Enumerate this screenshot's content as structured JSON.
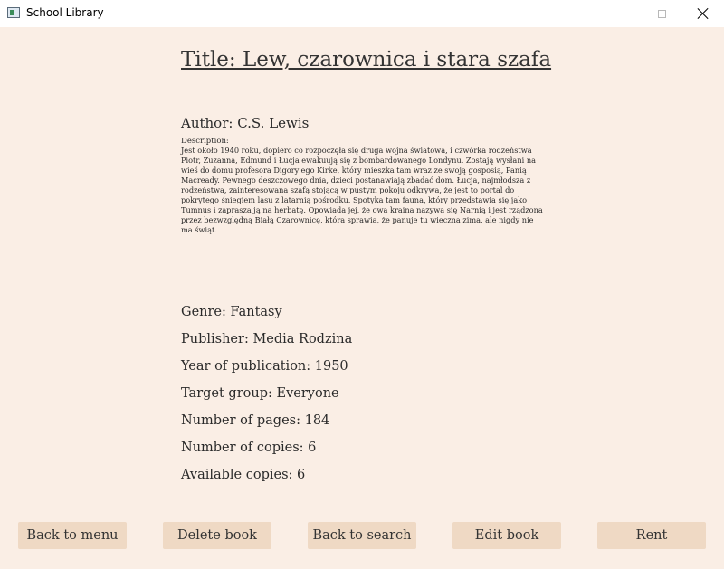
{
  "window": {
    "title": "School Library"
  },
  "book": {
    "title": "Title: Lew, czarownica i stara szafa",
    "author": "Author: C.S. Lewis",
    "description_label": "Description:",
    "description": "Jest około 1940 roku, dopiero co rozpoczęła się druga wojna światowa, i czwórka rodzeństwa Piotr, Zuzanna, Edmund i Łucja ewakuują się z bombardowanego Londynu. Zostają wysłani na wieś do domu profesora Digory'ego Kirke, który mieszka tam wraz ze swoją gosposią, Panią Macready. Pewnego deszczowego dnia, dzieci postanawiają zbadać dom. Łucja, najmłodsza z rodzeństwa, zainteresowana szafą stojącą w pustym pokoju odkrywa, że jest to portal do pokrytego śniegiem lasu z latarnią pośrodku. Spotyka tam fauna, który przedstawia się jako Tumnus i zaprasza ją na herbatę. Opowiada jej, że owa kraina nazywa się Narnią i jest rządzona przez bezwzględną Białą Czarownicę, która sprawia, że panuje tu wieczna zima, ale nigdy nie ma świąt.",
    "genre": "Genre: Fantasy",
    "publisher": "Publisher: Media Rodzina",
    "year": "Year of publication: 1950",
    "target_group": "Target group: Everyone",
    "pages": "Number of pages: 184",
    "copies": "Number of copies: 6",
    "available": "Available copies: 6"
  },
  "buttons": {
    "back_to_menu": "Back to menu",
    "delete_book": "Delete book",
    "back_to_search": "Back to search",
    "edit_book": "Edit book",
    "rent": "Rent"
  },
  "colors": {
    "background": "#faeee5",
    "button": "#efd9c4",
    "text": "#2a2a2a"
  },
  "icons": {
    "app": "app-window-icon",
    "minimize": "minimize-icon",
    "maximize": "maximize-icon",
    "close": "close-icon"
  }
}
